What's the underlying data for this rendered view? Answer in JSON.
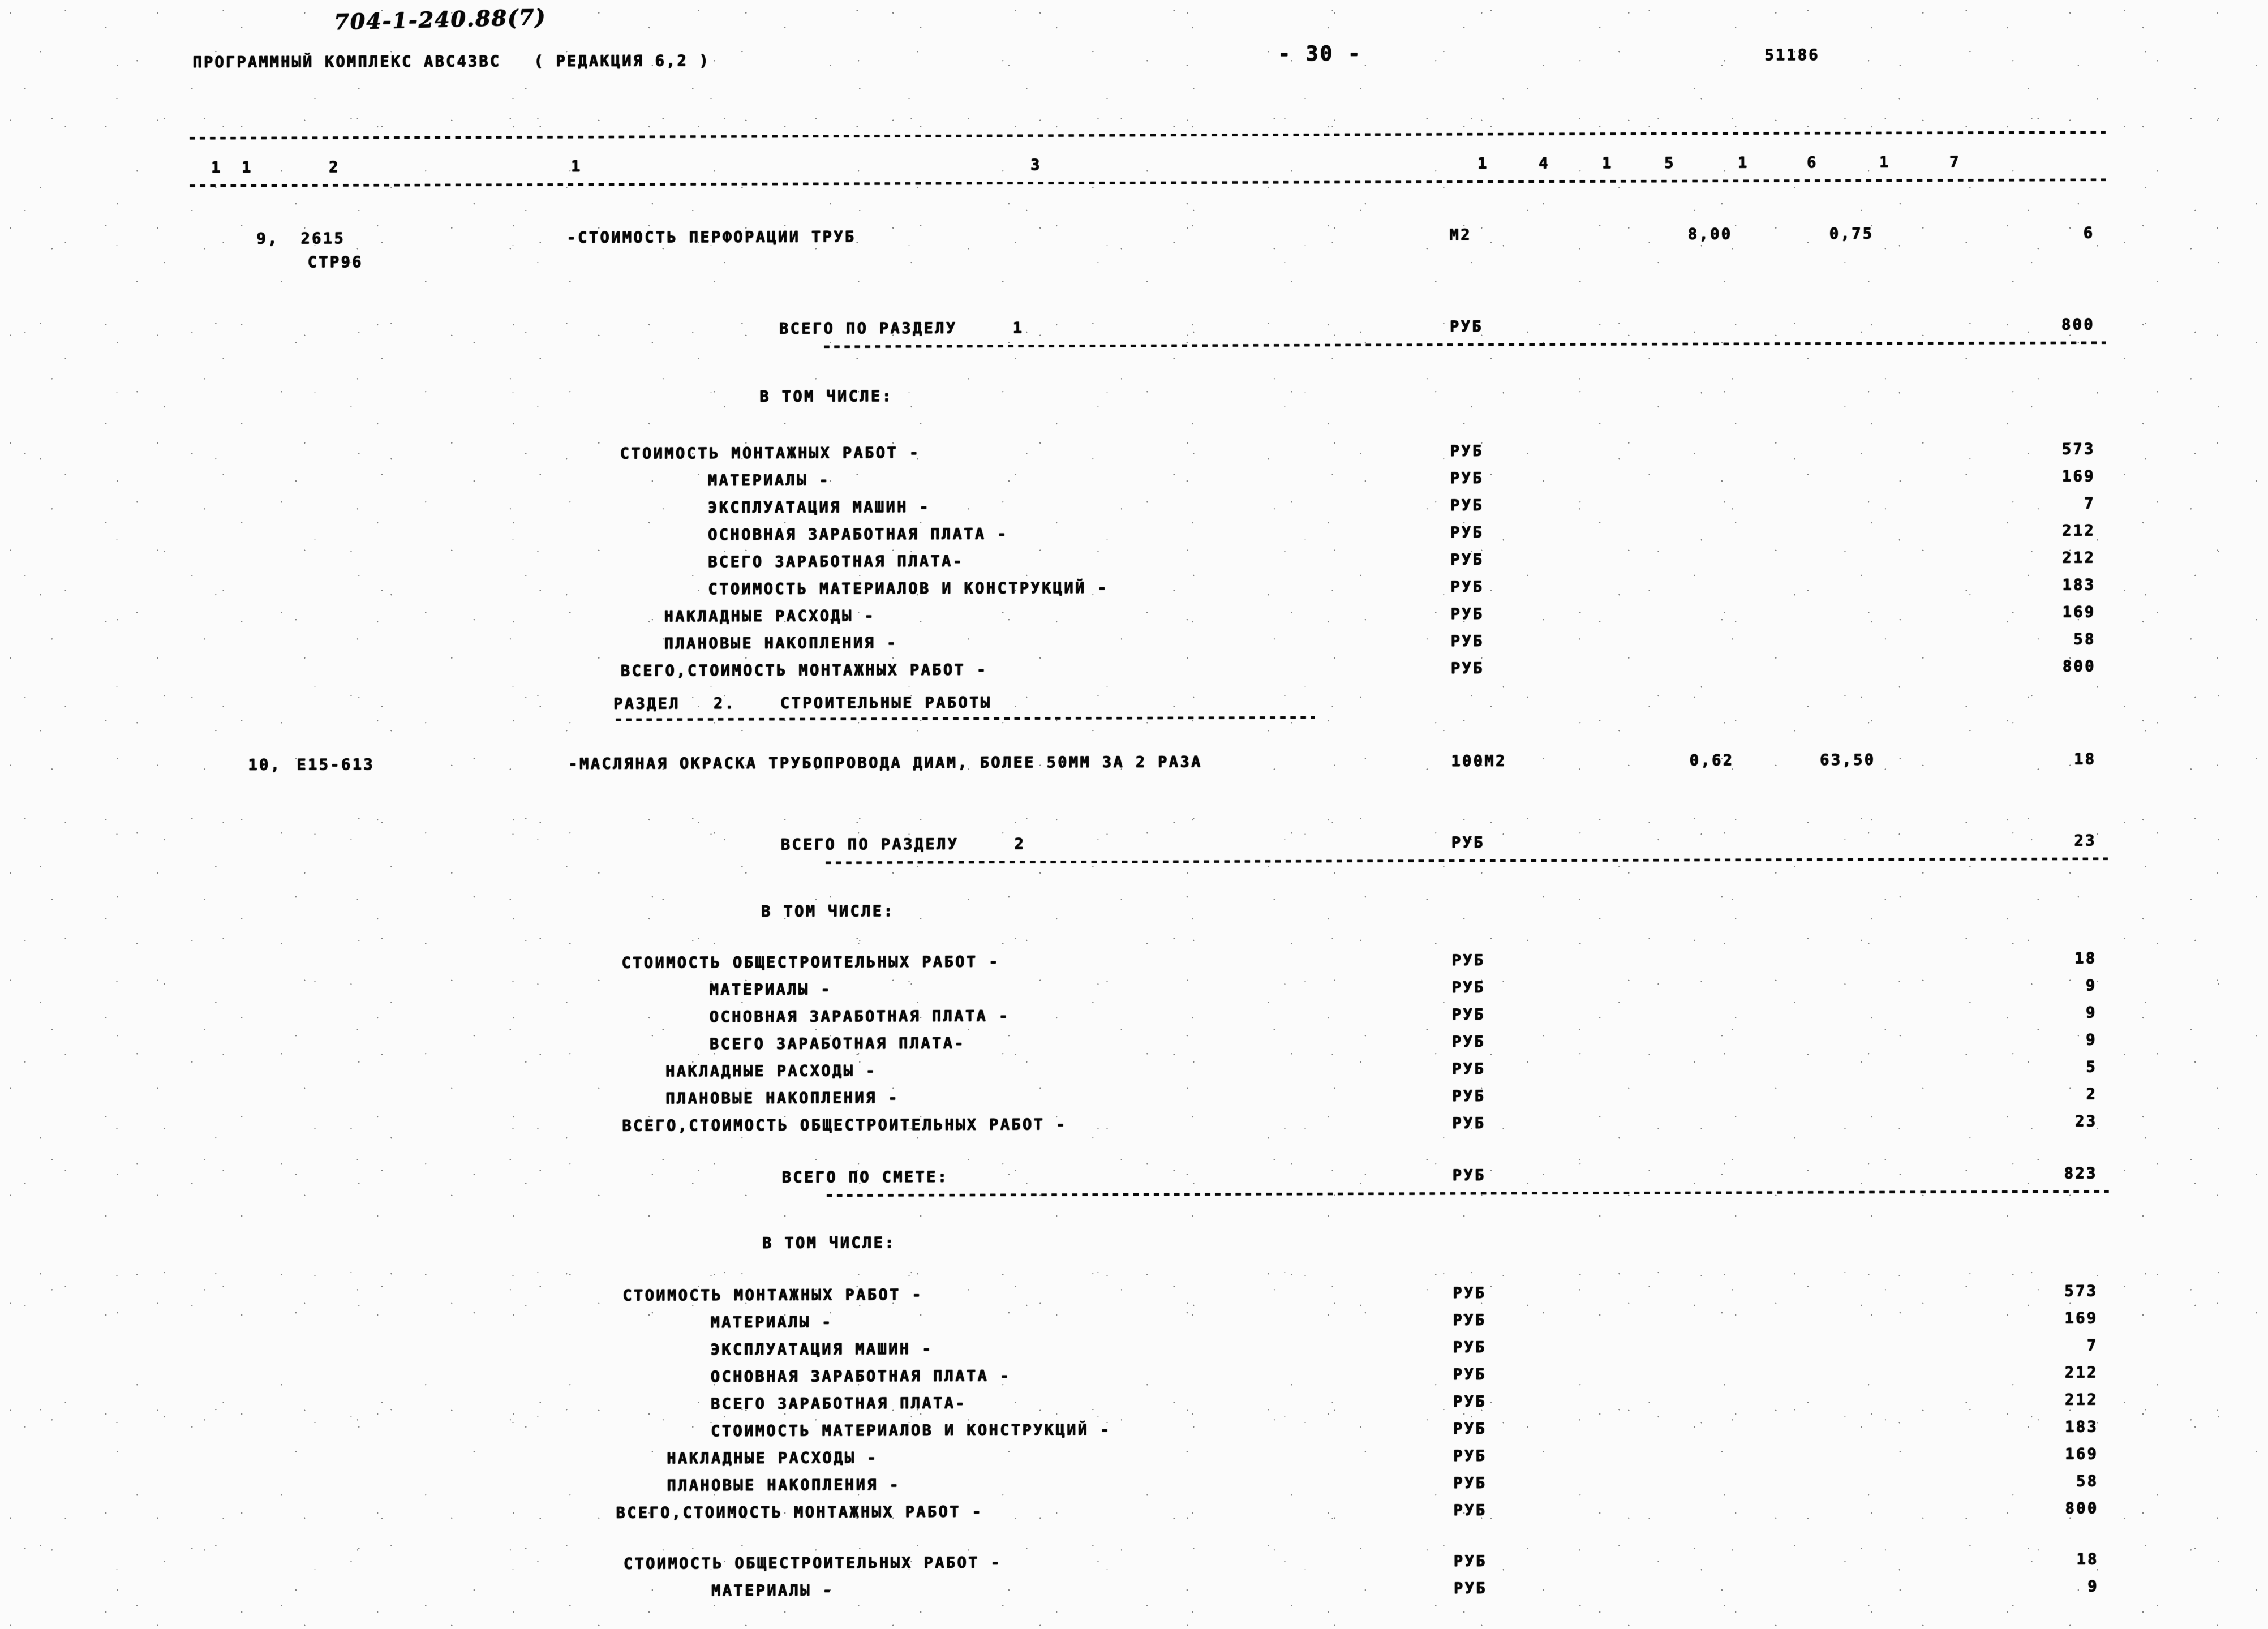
{
  "header": {
    "handwritten_code": "704-1-240.88(7)",
    "program_line": "ПРОГРАММНЫЙ КОМПЛЕКС АВС4ЗВС   ( РЕДАКЦИЯ 6,2 )",
    "page_marker": "- 30 -",
    "doc_number": "51186"
  },
  "table": {
    "column_numbers": [
      "1",
      "2",
      "3",
      "4",
      "5",
      "6",
      "7"
    ],
    "separator_dashes": "-"
  },
  "rows": [
    {
      "no": "9,",
      "code": "2615",
      "code2": "СТР96",
      "description": "-СТОИМОСТЬ ПЕРФОРАЦИИ ТРУБ",
      "unit": "М2",
      "qty": "8,00",
      "price": "0,75",
      "total": "6"
    },
    {
      "no": "10,",
      "code": "Е15-613",
      "code2": "",
      "description": "-МАСЛЯНАЯ ОКРАСКА ТРУБОПРОВОДА ДИАМ, БОЛЕЕ 50ММ ЗА 2 РАЗА",
      "unit": "100М2",
      "qty": "0,62",
      "price": "63,50",
      "total": "18"
    }
  ],
  "section1": {
    "total_label": "ВСЕГО ПО РАЗДЕЛУ     1",
    "total_unit": "РУБ",
    "total_value": "800",
    "breakdown_label": "В ТОМ ЧИСЛЕ:",
    "items": [
      {
        "label": "СТОИМОСТЬ МОНТАЖНЫХ РАБОТ -",
        "indent": 0,
        "unit": "РУБ",
        "value": "573"
      },
      {
        "label": "МАТЕРИАЛЫ -",
        "indent": 1,
        "unit": "РУБ",
        "value": "169"
      },
      {
        "label": "ЭКСПЛУАТАЦИЯ МАШИН -",
        "indent": 1,
        "unit": "РУБ",
        "value": "7"
      },
      {
        "label": "ОСНОВНАЯ ЗАРАБОТНАЯ ПЛАТА -",
        "indent": 1,
        "unit": "РУБ",
        "value": "212"
      },
      {
        "label": "ВСЕГО ЗАРАБОТНАЯ ПЛАТА-",
        "indent": 1,
        "unit": "РУБ",
        "value": "212"
      },
      {
        "label": "СТОИМОСТЬ МАТЕРИАЛОВ И КОНСТРУКЦИЙ -",
        "indent": 1,
        "unit": "РУБ",
        "value": "183"
      },
      {
        "label": "НАКЛАДНЫЕ РАСХОДЫ -",
        "indent": 0.5,
        "unit": "РУБ",
        "value": "169"
      },
      {
        "label": "ПЛАНОВЫЕ НАКОПЛЕНИЯ -",
        "indent": 0.5,
        "unit": "РУБ",
        "value": "58"
      },
      {
        "label": "ВСЕГО,СТОИМОСТЬ МОНТАЖНЫХ РАБОТ -",
        "indent": 0,
        "unit": "РУБ",
        "value": "800"
      }
    ]
  },
  "section2_heading": "РАЗДЕЛ   2.    СТРОИТЕЛЬНЫЕ РАБОТЫ",
  "section2": {
    "total_label": "ВСЕГО ПО РАЗДЕЛУ     2",
    "total_unit": "РУБ",
    "total_value": "23",
    "breakdown_label": "В ТОМ ЧИСЛЕ:",
    "items": [
      {
        "label": "СТОИМОСТЬ ОБЩЕСТРОИТЕЛЬНЫХ РАБОТ -",
        "indent": 0,
        "unit": "РУБ",
        "value": "18"
      },
      {
        "label": "МАТЕРИАЛЫ -",
        "indent": 1,
        "unit": "РУБ",
        "value": "9"
      },
      {
        "label": "ОСНОВНАЯ ЗАРАБОТНАЯ ПЛАТА -",
        "indent": 1,
        "unit": "РУБ",
        "value": "9"
      },
      {
        "label": "ВСЕГО ЗАРАБОТНАЯ ПЛАТА-",
        "indent": 1,
        "unit": "РУБ",
        "value": "9"
      },
      {
        "label": "НАКЛАДНЫЕ РАСХОДЫ -",
        "indent": 0.5,
        "unit": "РУБ",
        "value": "5"
      },
      {
        "label": "ПЛАНОВЫЕ НАКОПЛЕНИЯ -",
        "indent": 0.5,
        "unit": "РУБ",
        "value": "2"
      },
      {
        "label": "ВСЕГО,СТОИМОСТЬ ОБЩЕСТРОИТЕЛЬНЫХ РАБОТ -",
        "indent": 0,
        "unit": "РУБ",
        "value": "23"
      }
    ]
  },
  "grand": {
    "total_label": "ВСЕГО ПО СМЕТЕ:",
    "total_unit": "РУБ",
    "total_value": "823",
    "breakdown_label": "В ТОМ ЧИСЛЕ:",
    "items": [
      {
        "label": "СТОИМОСТЬ МОНТАЖНЫХ РАБОТ -",
        "indent": 0,
        "unit": "РУБ",
        "value": "573"
      },
      {
        "label": "МАТЕРИАЛЫ -",
        "indent": 1,
        "unit": "РУБ",
        "value": "169"
      },
      {
        "label": "ЭКСПЛУАТАЦИЯ МАШИН -",
        "indent": 1,
        "unit": "РУБ",
        "value": "7"
      },
      {
        "label": "ОСНОВНАЯ ЗАРАБОТНАЯ ПЛАТА -",
        "indent": 1,
        "unit": "РУБ",
        "value": "212"
      },
      {
        "label": "ВСЕГО ЗАРАБОТНАЯ ПЛАТА-",
        "indent": 1,
        "unit": "РУБ",
        "value": "212"
      },
      {
        "label": "СТОИМОСТЬ МАТЕРИАЛОВ И КОНСТРУКЦИЙ -",
        "indent": 1,
        "unit": "РУБ",
        "value": "183"
      },
      {
        "label": "НАКЛАДНЫЕ РАСХОДЫ -",
        "indent": 0.5,
        "unit": "РУБ",
        "value": "169"
      },
      {
        "label": "ПЛАНОВЫЕ НАКОПЛЕНИЯ -",
        "indent": 0.5,
        "unit": "РУБ",
        "value": "58"
      },
      {
        "label": "ВСЕГО,СТОИМОСТЬ МОНТАЖНЫХ РАБОТ -",
        "indent": 0,
        "unit": "РУБ",
        "value": "800"
      },
      {
        "label": "СТОИМОСТЬ ОБЩЕСТРОИТЕЛЬНЫХ РАБОТ -",
        "indent": 0,
        "unit": "РУБ",
        "value": "18",
        "gap": true
      },
      {
        "label": "МАТЕРИАЛЫ -",
        "indent": 1,
        "unit": "РУБ",
        "value": "9"
      }
    ]
  }
}
